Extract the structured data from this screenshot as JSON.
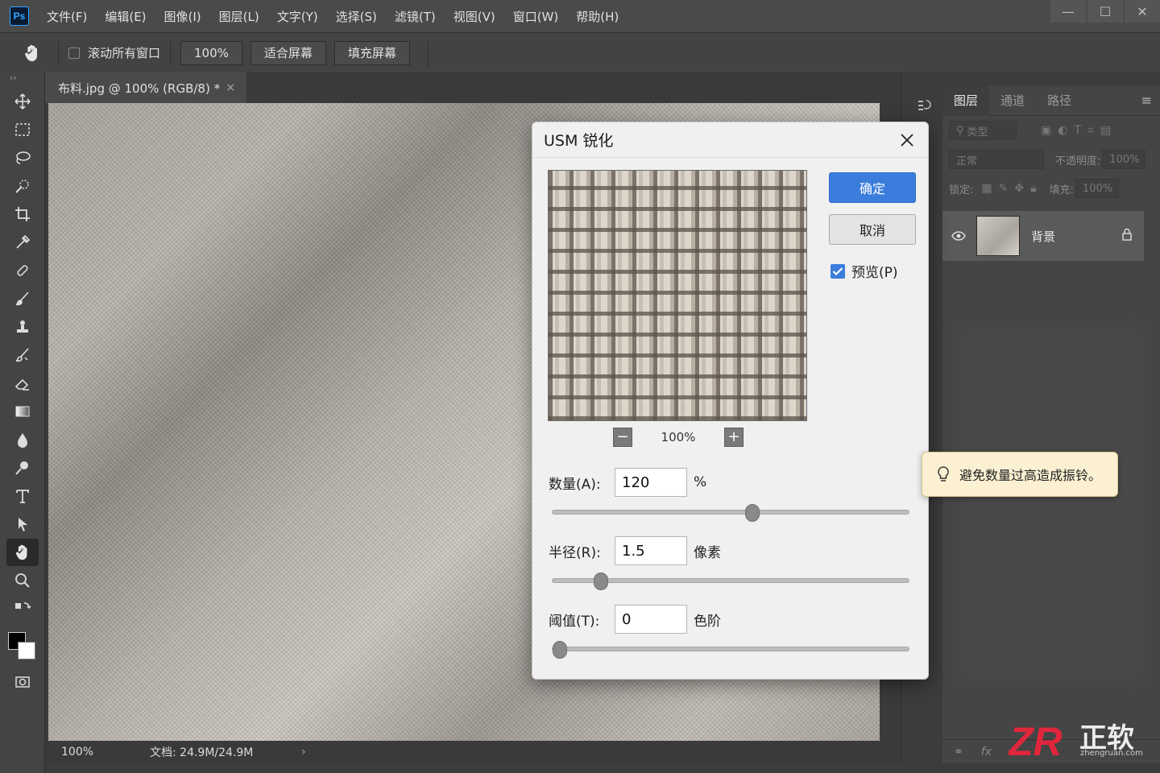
{
  "app": {
    "logo_text": "Ps"
  },
  "menu": [
    "文件(F)",
    "编辑(E)",
    "图像(I)",
    "图层(L)",
    "文字(Y)",
    "选择(S)",
    "滤镜(T)",
    "视图(V)",
    "窗口(W)",
    "帮助(H)"
  ],
  "window_controls": {
    "minimize": "—",
    "maximize": "☐",
    "close": "✕"
  },
  "options": {
    "scroll_all_label": "滚动所有窗口",
    "scroll_all_checked": false,
    "zoom_btn": "100%",
    "fit_screen_btn": "适合屏幕",
    "fill_screen_btn": "填充屏幕"
  },
  "document": {
    "tab_title": "布料.jpg @ 100% (RGB/8) *",
    "close": "×"
  },
  "status": {
    "zoom": "100%",
    "doc_info": "文档: 24.9M/24.9M",
    "arrow": "›"
  },
  "layers_panel": {
    "tabs": [
      "图层",
      "通道",
      "路径"
    ],
    "filter_kind": "类型",
    "blend_mode": "正常",
    "opacity_label": "不透明度:",
    "opacity_value": "100%",
    "lock_label": "锁定:",
    "fill_label": "填充:",
    "fill_value": "100%",
    "layer_name": "背景",
    "bottom_icons": [
      "link-icon",
      "fx-icon"
    ]
  },
  "dialog": {
    "title": "USM 锐化",
    "ok": "确定",
    "cancel": "取消",
    "preview_label": "预览(P)",
    "preview_checked": true,
    "zoom_minus": "−",
    "zoom_plus": "+",
    "preview_zoom": "100%",
    "params": [
      {
        "label": "数量(A):",
        "value": "120",
        "unit": "%",
        "slider_fraction": 0.56
      },
      {
        "label": "半径(R):",
        "value": "1.5",
        "unit": "像素",
        "slider_fraction": 0.135
      },
      {
        "label": "阈值(T):",
        "value": "0",
        "unit": "色阶",
        "slider_fraction": 0.02
      }
    ]
  },
  "tooltip": {
    "text": "避免数量过高造成振铃。"
  },
  "watermark": {
    "brand": "正软",
    "url": "zhengruan.com"
  },
  "colors": {
    "accent": "#3b7ddd",
    "tooltip_bg": "#fbf0d2",
    "watermark_red": "#e0263c"
  }
}
